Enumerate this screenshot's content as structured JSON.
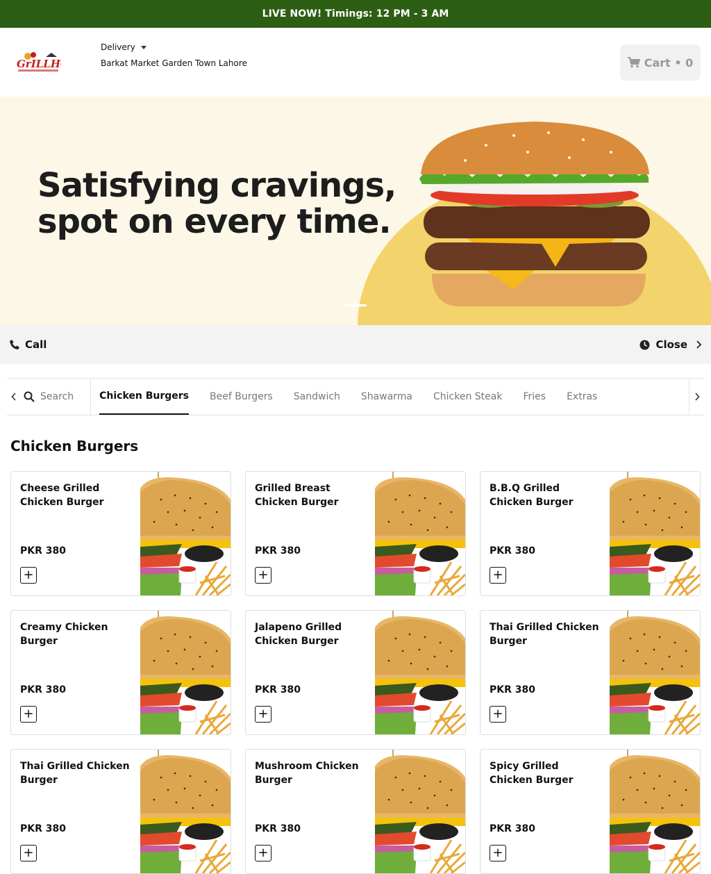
{
  "topbar": {
    "text": "LIVE NOW! Timings: 12 PM - 3 AM"
  },
  "header": {
    "logo": {
      "text": "GRILL HOT",
      "tagline": "BURGERS | STEAKS | SANDWICHES"
    },
    "delivery_mode": "Delivery",
    "address": "Barkat Market Garden Town Lahore",
    "cart_label": "Cart • 0"
  },
  "hero": {
    "headline_line1": "Satisfying cravings,",
    "headline_line2": "spot on every time."
  },
  "infobar": {
    "call_label": "Call",
    "status_label": "Close"
  },
  "nav": {
    "search_placeholder": "Search",
    "categories": [
      "Chicken Burgers",
      "Beef Burgers",
      "Sandwich",
      "Shawarma",
      "Chicken Steak",
      "Fries",
      "Extras"
    ],
    "active": "Chicken Burgers"
  },
  "section": {
    "title": "Chicken Burgers"
  },
  "products": [
    {
      "name": "Cheese Grilled Chicken Burger",
      "price": "PKR 380"
    },
    {
      "name": "Grilled Breast Chicken Burger",
      "price": "PKR 380"
    },
    {
      "name": "B.B.Q Grilled Chicken Burger",
      "price": "PKR 380"
    },
    {
      "name": "Creamy Chicken Burger",
      "price": "PKR 380"
    },
    {
      "name": "Jalapeno Grilled Chicken Burger",
      "price": "PKR 380"
    },
    {
      "name": "Thai Grilled Chicken Burger",
      "price": "PKR 380"
    },
    {
      "name": "Thai Grilled Chicken Burger",
      "price": "PKR 380"
    },
    {
      "name": "Mushroom Chicken Burger",
      "price": "PKR 380"
    },
    {
      "name": "Spicy Grilled Chicken Burger",
      "price": "PKR 380"
    }
  ],
  "colors": {
    "topbar": "#2c5f14",
    "hero_bg": "#fcf7e7",
    "hero_accent": "#f3d36b"
  }
}
